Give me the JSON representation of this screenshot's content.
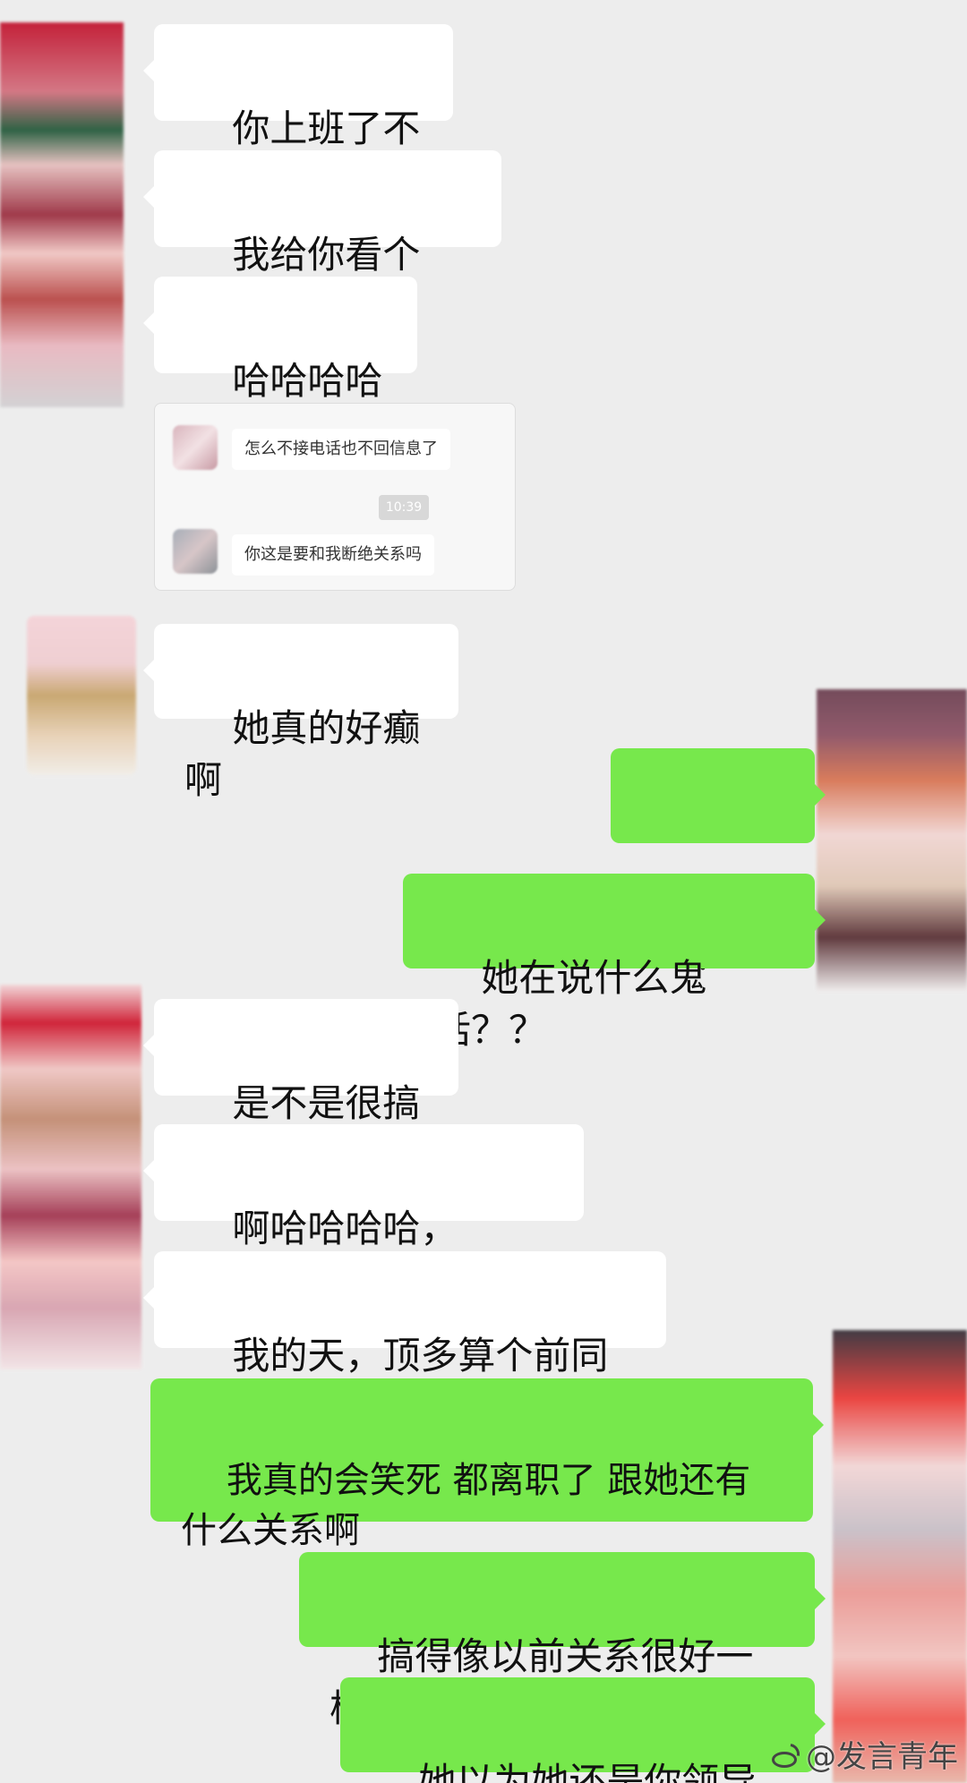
{
  "messages": [
    {
      "text": "你上班了不～"
    },
    {
      "text": "我给你看个"
    },
    {
      "text": "哈哈哈哈哈"
    },
    {
      "text": "她真的好癫啊"
    },
    {
      "text": "？？？？"
    },
    {
      "text": "她在说什么鬼话？？"
    },
    {
      "text": "是不是很搞笑"
    },
    {
      "text": "啊哈哈哈哈，"
    },
    {
      "text": "我的天，顶多算个前同事"
    },
    {
      "text": "我真的会笑死 都离职了 跟她还有\n什么关系啊"
    },
    {
      "text": "搞得像以前关系很好一样"
    },
    {
      "text": "她以为她还是你领导啊"
    }
  ],
  "screenshot": {
    "message1": "怎么不接电话也不回信息了",
    "time": "10:39",
    "message2": "你这是要和我断绝关系吗"
  },
  "watermark": {
    "handle": "@发言青年"
  },
  "colors": {
    "background": "#ededed",
    "incoming_bubble": "#ffffff",
    "outgoing_bubble": "#77e84c"
  },
  "icons": {
    "watermark": "weibo-icon",
    "avatars": "blurred-avatar"
  }
}
